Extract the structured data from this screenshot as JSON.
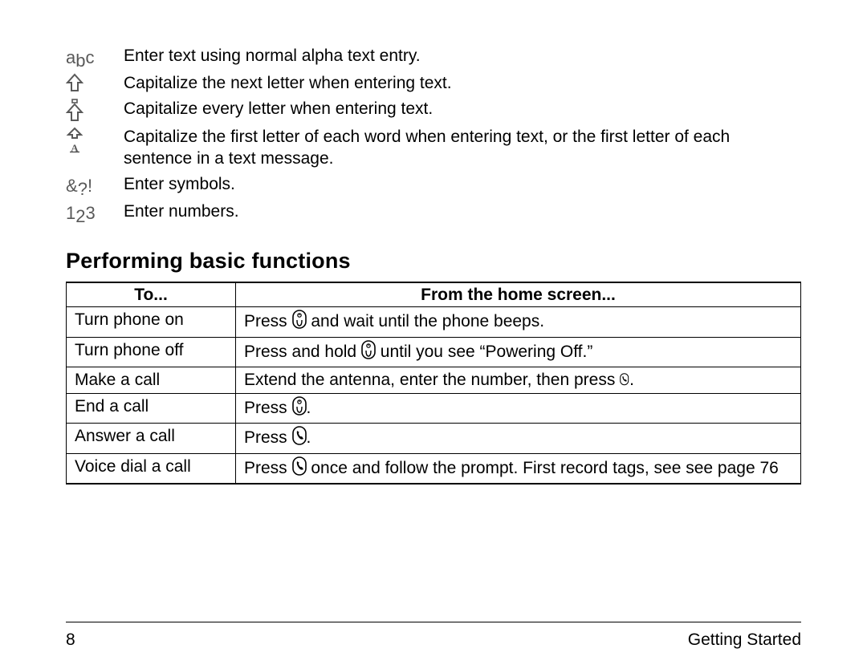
{
  "defs": [
    {
      "icon": "abc-icon",
      "text": "Enter text using normal alpha text entry."
    },
    {
      "icon": "shift-next-icon",
      "text": "Capitalize the next letter when entering text."
    },
    {
      "icon": "shift-lock-icon",
      "text": "Capitalize every letter when entering text."
    },
    {
      "icon": "shift-word-icon",
      "text": "Capitalize the first letter of each word when entering text, or the first letter of each sentence in a text message."
    },
    {
      "icon": "symbols-icon",
      "text": "Enter symbols."
    },
    {
      "icon": "numbers-icon",
      "text": "Enter numbers."
    }
  ],
  "abc_glyph": {
    "a": "a",
    "b": "b",
    "c": "c"
  },
  "symbols_glyph": "&?!",
  "numbers_glyph": {
    "a": "1",
    "b": "2",
    "c": "3"
  },
  "heading": "Performing basic functions",
  "table": {
    "header": {
      "to": "To...",
      "action": "From the home screen..."
    },
    "rows": [
      {
        "to": "Turn phone on",
        "pre": "Press ",
        "icon": "power-key-icon",
        "post": " and wait until the phone beeps."
      },
      {
        "to": "Turn phone off",
        "pre": "Press and hold ",
        "icon": "power-key-icon",
        "post": " until you see “Powering Off.”"
      },
      {
        "to": "Make a call",
        "pre": "Extend the antenna, enter the number, then press ",
        "icon": "call-key-small-icon",
        "post": "."
      },
      {
        "to": "End a call",
        "pre": "Press ",
        "icon": "power-key-icon",
        "post": "."
      },
      {
        "to": "Answer a call",
        "pre": "Press ",
        "icon": "call-key-icon",
        "post": "."
      },
      {
        "to": "Voice dial a call",
        "pre": "Press ",
        "icon": "call-key-icon",
        "post": " once and follow the prompt. First record tags, see see page 76"
      }
    ]
  },
  "footer": {
    "page": "8",
    "section": "Getting Started"
  }
}
